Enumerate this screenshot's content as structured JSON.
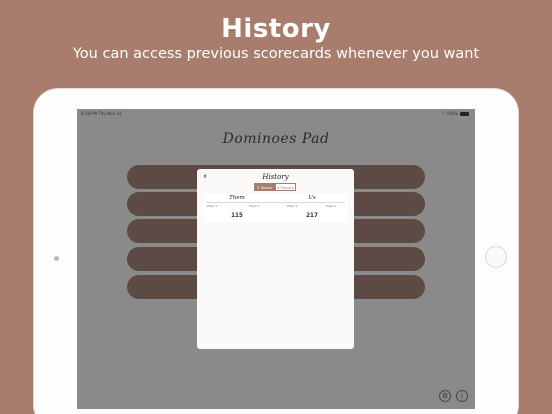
{
  "hero": {
    "title": "History",
    "subtitle": "You can access previous scorecards whenever you want"
  },
  "status_bar": {
    "time_date": "9:38 PM  Thu Nov 14",
    "battery_text": "100%"
  },
  "app": {
    "title": "Dominoes Pad",
    "menu_bar_count": 5
  },
  "history_modal": {
    "title": "History",
    "back_icon": "chevron-left-icon",
    "segments": [
      {
        "label": "2 Teams",
        "active": true
      },
      {
        "label": "4 Players",
        "active": false
      }
    ],
    "scorecard": {
      "teams": [
        {
          "name": "Them",
          "players": [
            "Player 1",
            "Player 3"
          ],
          "score": "115"
        },
        {
          "name": "Us",
          "players": [
            "Player 2",
            "Player 4"
          ],
          "score": "217"
        }
      ]
    }
  },
  "bottom_icons": [
    "gear-icon",
    "info-icon"
  ],
  "colors": {
    "background": "#a97d6d",
    "menu_bar": "#5d4a44",
    "screen_dim": "#8a8a8a",
    "accent": "#a97d6d"
  }
}
